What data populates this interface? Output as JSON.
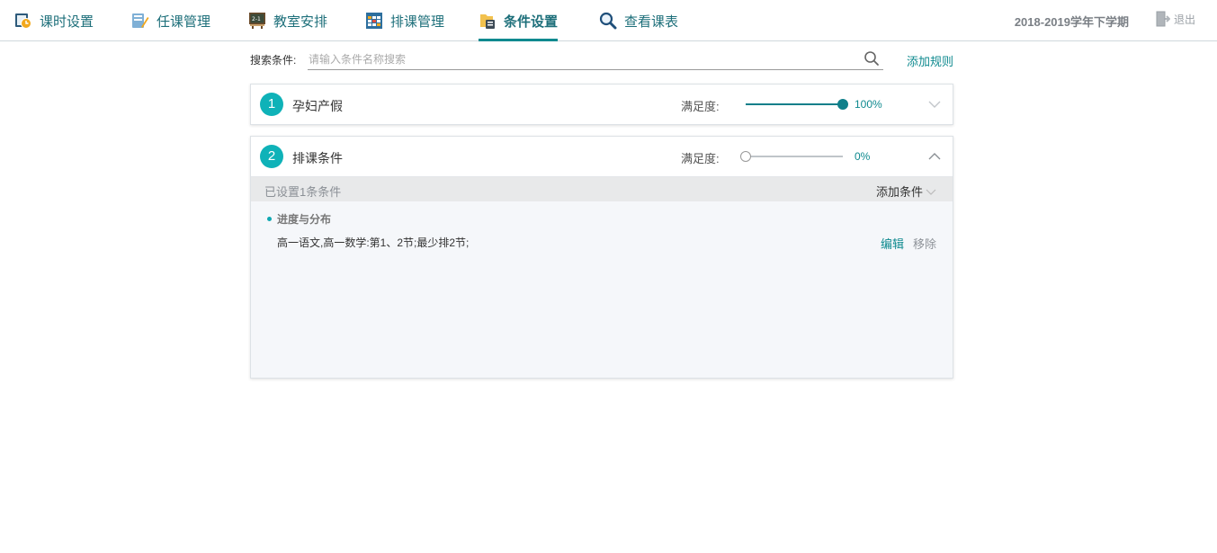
{
  "nav": {
    "items": [
      {
        "label": "课时设置",
        "icon": "clock-settings-icon"
      },
      {
        "label": "任课管理",
        "icon": "teacher-assign-icon"
      },
      {
        "label": "教室安排",
        "icon": "classroom-board-icon"
      },
      {
        "label": "排课管理",
        "icon": "schedule-grid-icon"
      },
      {
        "label": "条件设置",
        "icon": "condition-folder-icon"
      },
      {
        "label": "查看课表",
        "icon": "magnifier-icon"
      }
    ],
    "active_index": 4,
    "term": "2018-2019学年下学期",
    "logout": "退出"
  },
  "search": {
    "label": "搜索条件:",
    "placeholder": "请输入条件名称搜索",
    "value": "",
    "add_rule": "添加规则"
  },
  "rules": [
    {
      "number": "1",
      "name": "孕妇产假",
      "satisfaction_label": "满足度:",
      "satisfaction": 1.0,
      "satisfaction_text": "100%",
      "expanded": false
    },
    {
      "number": "2",
      "name": "排课条件",
      "satisfaction_label": "满足度:",
      "satisfaction": 0.0,
      "satisfaction_text": "0%",
      "expanded": true
    }
  ],
  "rule_body": {
    "count_text": "已设置1条条件",
    "add_condition": "添加条件",
    "conditions": [
      {
        "title": "进度与分布",
        "detail": "高一语文,高一数学:第1、2节;最少排2节;",
        "edit": "编辑",
        "remove": "移除"
      }
    ]
  },
  "colors": {
    "accent": "#0f8a8f",
    "badge": "#0fb2b8",
    "nav_text": "#1d6f7a"
  }
}
